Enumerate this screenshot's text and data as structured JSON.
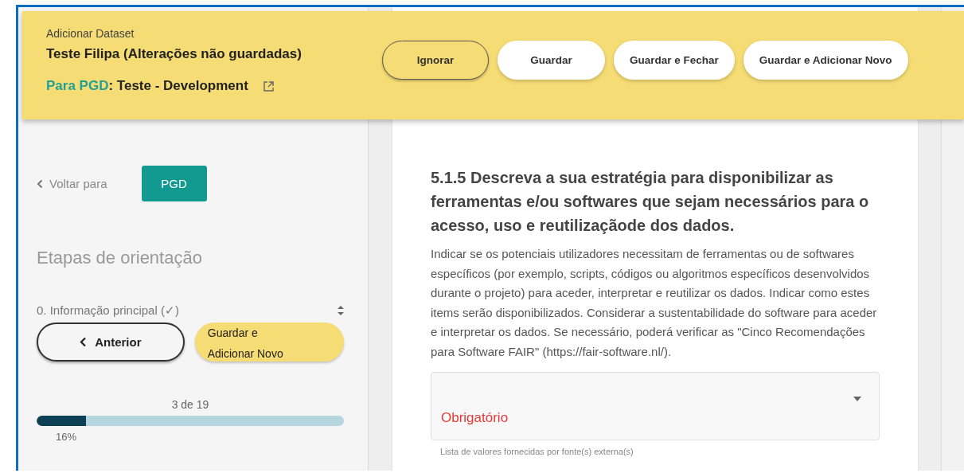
{
  "header": {
    "subtitle": "Adicionar Dataset",
    "title": "Teste Filipa (Alterações não guardadas)",
    "pgd_link": "Para PGD",
    "pgd_name": ": Teste - Development",
    "buttons": [
      {
        "label": "Ignorar",
        "kind": "outline"
      },
      {
        "label": "Guardar",
        "kind": "white"
      },
      {
        "label": "Guardar e Fechar",
        "kind": "white"
      },
      {
        "label": "Guardar e Adicionar Novo",
        "kind": "white"
      }
    ]
  },
  "sidebar": {
    "back_label": "Voltar para",
    "back_button": "PGD",
    "steps_title": "Etapas de orientação",
    "current_step": "0. Informação principal (✓)",
    "nav_buttons": [
      {
        "label": "Anterior",
        "kind": "previous"
      },
      {
        "label": "Guardar e Adicionar Novo",
        "kind": "save"
      }
    ],
    "progress": {
      "label": "3 de 19",
      "level": 0.16,
      "percent": "16%"
    }
  },
  "question": {
    "title": "5.1.5 Descreva a sua estratégia para disponibilizar as ferramentas e/ou softwares que sejam necessários para o acesso, uso e reutilizaçãode dos dados.",
    "description": "Indicar se os potenciais utilizadores necessitam de ferramentas ou de softwares específicos (por exemplo, scripts, códigos ou algoritmos específicos desenvolvidos durante o projeto) para aceder, interpretar e reutilizar os dados. Indicar como estes items serão disponibilizados. Considerar a sustentabilidade do software para aceder e interpretar os dados. Se necessário, poderá verificar as \"Cinco Recomendações para Software FAIR\" (https://fair-software.nl/).",
    "select_error": "Obrigatório",
    "hint": "Lista de valores fornecidas por fonte(s) externa(s)"
  }
}
